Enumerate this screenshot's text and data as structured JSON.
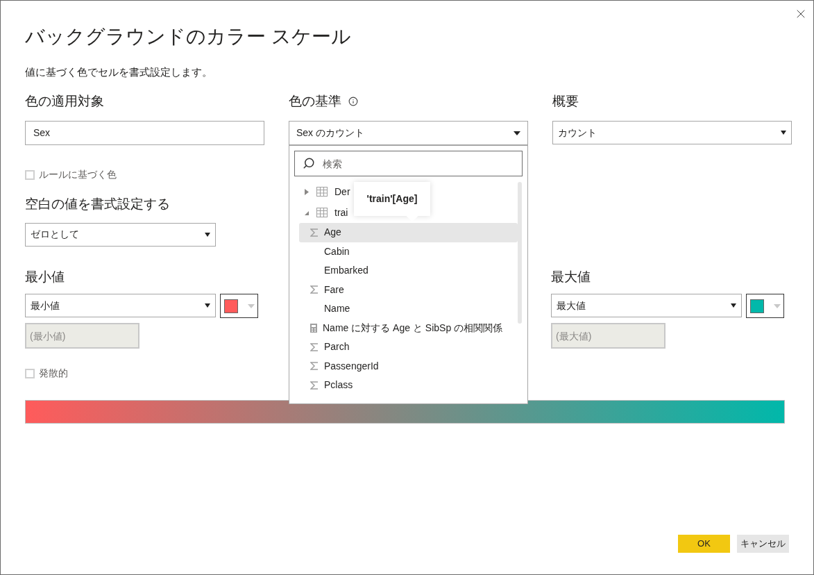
{
  "window": {
    "title": "バックグラウンドのカラー スケール",
    "description": "値に基づく色でセルを書式設定します。"
  },
  "apply_to": {
    "label": "色の適用対象",
    "value": "Sex"
  },
  "based_on": {
    "label": "色の基準",
    "value": "Sex のカウント",
    "expanded": true,
    "search": {
      "placeholder": "検索"
    },
    "tooltip": "'train'[Age]",
    "tree": [
      {
        "label": "Der",
        "expanded": false
      },
      {
        "label": "trai",
        "expanded": true,
        "children": [
          {
            "label": "Age",
            "kind": "sum",
            "selected": true
          },
          {
            "label": "Cabin",
            "kind": "text",
            "selected": false
          },
          {
            "label": "Embarked",
            "kind": "text",
            "selected": false
          },
          {
            "label": "Fare",
            "kind": "sum",
            "selected": false
          },
          {
            "label": "Name",
            "kind": "text",
            "selected": false
          },
          {
            "label": "Name に対する Age と SibSp の相関関係",
            "kind": "calc",
            "selected": false
          },
          {
            "label": "Parch",
            "kind": "sum",
            "selected": false
          },
          {
            "label": "PassengerId",
            "kind": "sum",
            "selected": false
          },
          {
            "label": "Pclass",
            "kind": "sum",
            "selected": false
          }
        ]
      }
    ]
  },
  "summary": {
    "label": "概要",
    "value": "カウント"
  },
  "rule_based": {
    "label": "ルールに基づく色",
    "checked": false
  },
  "blank_values": {
    "label": "空白の値を書式設定する",
    "value": "ゼロとして"
  },
  "minimum": {
    "label": "最小値",
    "value": "最小値",
    "color": "#ff5b5b",
    "placeholder": "(最小値)"
  },
  "diverging": {
    "label": "発散的",
    "checked": false
  },
  "maximum": {
    "label": "最大値",
    "value": "最大値",
    "color": "#01b8aa",
    "placeholder": "(最大値)"
  },
  "buttons": [
    {
      "label": "OK",
      "kind": "primary"
    },
    {
      "label": "キャンセル",
      "kind": "secondary"
    }
  ]
}
